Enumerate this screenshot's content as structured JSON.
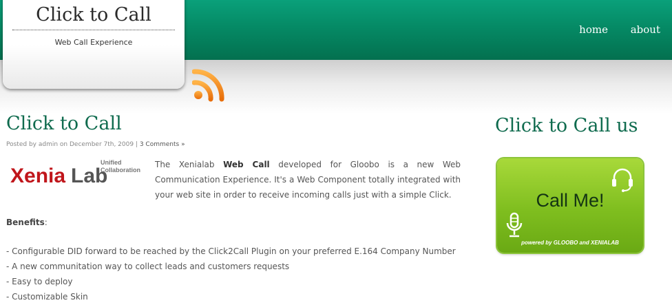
{
  "site": {
    "title": "Click to Call",
    "subtitle": "Web Call Experience"
  },
  "nav": {
    "items": [
      {
        "label": "home"
      },
      {
        "label": "about"
      }
    ]
  },
  "icons": {
    "rss": "rss-feed-icon",
    "headset": "headset-icon",
    "microphone": "microphone-icon"
  },
  "post": {
    "title": "Click to Call",
    "meta_prefix": "Posted by admin on December 7th, 2009 | ",
    "comments_link": "3 Comments »",
    "logo": {
      "brand_part1": "Xenia",
      "brand_part2": "Lab",
      "tagline_line1": "Unified",
      "tagline_line2": "Collaboration"
    },
    "intro_before": "The Xenialab ",
    "intro_bold": "Web Call",
    "intro_after": " developed for Gloobo is a new Web Communication Experience. It's a Web Component totally integrated with your web site in order to receive incoming calls just with a simple Click.",
    "benefits_label": "Benefits",
    "benefits_colon": ":",
    "bullets": [
      "- Configurable DID forward to be reached by the Click2Call Plugin on your preferred E.164 Company Number",
      "- A new communitation way to collect leads and customers requests",
      "- Easy to deploy",
      "- Customizable Skin"
    ]
  },
  "sidebar": {
    "title": "Click to Call us",
    "widget": {
      "label": "Call Me!",
      "powered_by": "powered by GLOOBO and XENIALAB"
    }
  },
  "colors": {
    "header_green": "#058a65",
    "title_green": "#0f6b4e",
    "button_green": "#7fbe1f",
    "rss_orange": "#f7941d",
    "logo_red": "#c0161b"
  }
}
